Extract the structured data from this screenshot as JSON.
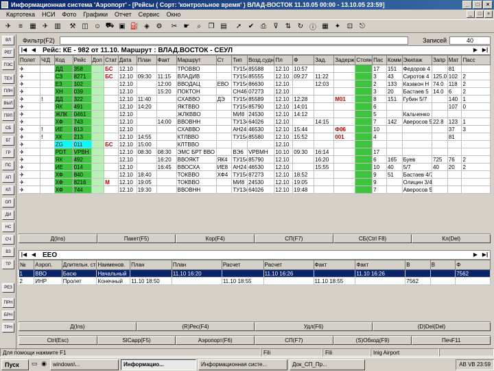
{
  "window": {
    "title": "Информационная система 'Аэропорт' - [Рейсы ( Сорт: 'контрольное время' ) ВЛАД-ВОСТОК 11.10.05 00:00 - 13.10.05 23:59]",
    "min": "_",
    "max": "□",
    "close": "×"
  },
  "menu": [
    "Картотека",
    "НСИ",
    "Фото",
    "Графики",
    "Отчет",
    "Сервис",
    "Окно"
  ],
  "mdi_controls": [
    "_",
    "□",
    "×"
  ],
  "left_tools": [
    "ВЛ",
    "РЕГ",
    "ПЭС",
    "ТЕХ",
    "ПЛН",
    "ВЫЛ",
    "ПРЛ",
    "СБ",
    "БГ",
    "ГР",
    "ПС",
    "АП",
    "КЛ",
    "ОП",
    "ДИ",
    "НС",
    "СЧ",
    "ВЗ",
    "ТР",
    "РЕЗ",
    "ПРН",
    "БРН",
    "ТРН"
  ],
  "flights": {
    "filter_label": "Фильтр(F2)",
    "filter_value": "",
    "record_label": "Записей",
    "record_count": "40",
    "header": "Рейс: КЕ - 982 от 11.10. Маршрут : ВЛАД.ВОСТОК - СЕУЛ",
    "columns": [
      "Полет",
      "Ч/Д",
      "Код",
      "Рейс",
      "Доп",
      "Стат",
      "Дата",
      "План",
      "Факт",
      "Маршрут",
      "Ст",
      "Тип",
      "Возд.судно",
      "Пл",
      "Ф",
      "Зад.",
      "Задерж",
      "Стоян",
      "Пас",
      "Комм",
      "Экипаж",
      "Запр",
      "Мат",
      "Пасс"
    ],
    "rows": [
      {
        "d": "✈",
        "cd": "ДД",
        "num": "358",
        "st": "",
        "extra": "БС",
        "date": "12.10",
        "plan": "",
        "fact": "",
        "route": "ТРОВВО",
        "s": "",
        "type": "ТУ154",
        "ac": "85588",
        "t1": "12.10",
        "t2": "10:57",
        "t3": "",
        "delay": "",
        "stand": "17",
        "pax": "151",
        "comm": "Федоров 4",
        "crew": "",
        "z": "",
        "m": "81",
        "p": "",
        "hl": ""
      },
      {
        "d": "✈",
        "cd": "СЗ",
        "num": "8271",
        "st": "",
        "extra": "БС",
        "date": "12.10",
        "plan": "09:30",
        "fact": "11:15",
        "route": "ВЛАДИВ",
        "s": "",
        "type": "ТУ154",
        "ac": "85555",
        "t1": "12.10",
        "t2": "09:27",
        "t3": "11:22",
        "delay": "",
        "stand": "3",
        "pax": "43",
        "comm": "Сиротов 4",
        "crew": "125.0",
        "z": "FE",
        "m": "102",
        "p": "2",
        "hl": ""
      },
      {
        "d": "✈",
        "cd": "ЕЗ",
        "num": "102",
        "st": "",
        "extra": "",
        "date": "12.10",
        "plan": "",
        "fact": "12:00",
        "route": "ВВОДАЦ",
        "s": "ЕВО",
        "type": "ТУ154",
        "ac": "86630",
        "t1": "12.10",
        "t2": "",
        "t3": "12:03",
        "delay": "",
        "stand": "2",
        "pax": "133",
        "comm": "Казакон Н",
        "crew": "74.0",
        "z": "",
        "m": "118",
        "p": "2",
        "hl": ""
      },
      {
        "d": "✈",
        "cd": "ХН",
        "num": "039",
        "st": "",
        "extra": "",
        "date": "12.10",
        "plan": "",
        "fact": "15:20",
        "route": "ПОКТОН",
        "s": "",
        "type": "СН46",
        "ac": "07273",
        "t1": "12.10",
        "t2": "",
        "t3": "",
        "delay": "",
        "stand": "3",
        "pax": "20",
        "comm": "Бастаев 5",
        "crew": "14.0",
        "z": "",
        "m": "6",
        "p": "2",
        "hl": ""
      },
      {
        "d": "✈",
        "cd": "ДД",
        "num": "322",
        "st": "",
        "extra": "",
        "date": "12.10",
        "plan": "11:40",
        "fact": "",
        "route": "СХАВВО",
        "s": "ДЭ",
        "type": "ТУ154",
        "ac": "85589",
        "t1": "12.10",
        "t2": "12:28",
        "t3": "",
        "delay": "М01",
        "stand": "8",
        "pax": "151",
        "comm": "Губин 5/7",
        "crew": "",
        "z": "",
        "m": "140",
        "p": "1",
        "hl": "!"
      },
      {
        "d": "✈",
        "cd": "ЯК",
        "num": "491",
        "st": "",
        "extra": "",
        "date": "12.10",
        "plan": "14:20",
        "fact": "",
        "route": "ЯКТВВО",
        "s": "",
        "type": "ТУ154",
        "ac": "85790",
        "t1": "12.10",
        "t2": "14:01",
        "t3": "",
        "delay": "",
        "stand": "6",
        "pax": "",
        "comm": "",
        "crew": "",
        "z": "",
        "m": "107",
        "p": "0",
        "hl": ""
      },
      {
        "d": "✈",
        "cd": "ЖЛК",
        "num": "0461",
        "st": "",
        "extra": "",
        "date": "12.10",
        "plan": "",
        "fact": "",
        "route": "ЖЛКВВО",
        "s": "",
        "type": "МИ8",
        "ac": "24530",
        "t1": "12.10",
        "t2": "14:12",
        "t3": "",
        "delay": "",
        "stand": "5",
        "pax": "",
        "comm": "Кальченко",
        "crew": "",
        "z": "",
        "m": "",
        "p": "",
        "hl": ""
      },
      {
        "d": "✈",
        "cd": "ХФ",
        "num": "743",
        "st": "",
        "extra": "",
        "date": "12.10",
        "plan": "",
        "fact": "14:00",
        "route": "ВВОВНН",
        "s": "",
        "type": "ТУ134",
        "ac": "64026",
        "t1": "12.10",
        "t2": "",
        "t3": "14:15",
        "delay": "",
        "stand": "7",
        "pax": "142",
        "comm": "Аверосов 5",
        "crew": "22.8",
        "z": "БЕ",
        "m": "123",
        "p": "1",
        "hl": ""
      },
      {
        "d": "✈",
        "cd": "ИЕ",
        "num": "813",
        "st": "",
        "extra": "",
        "date": "12.10",
        "plan": "",
        "fact": "",
        "route": "СХАВВО",
        "s": "",
        "type": "АН24",
        "ac": "46530",
        "t1": "12.10",
        "t2": "15:44",
        "t3": "",
        "delay": "Ф06",
        "stand": "10",
        "pax": "",
        "comm": "",
        "crew": "",
        "z": "",
        "m": "37",
        "p": "3",
        "hl": "!"
      },
      {
        "d": "✈",
        "cd": "ХК",
        "num": "213",
        "st": "",
        "extra": "",
        "date": "12.10",
        "plan": "14:55",
        "fact": "",
        "route": "КТЛВВО",
        "s": "",
        "type": "ТУ154",
        "ac": "85580",
        "t1": "12.10",
        "t2": "15:52",
        "t3": "",
        "delay": "001",
        "stand": "4",
        "pax": "",
        "comm": "",
        "crew": "",
        "z": "",
        "m": "81",
        "p": "",
        "hl": "!"
      },
      {
        "d": "✈",
        "cd": "ZG",
        "num": "011",
        "st": "",
        "extra": "БС",
        "date": "12.10",
        "plan": "15:00",
        "fact": "",
        "route": "КЛТВВО",
        "s": "",
        "type": "",
        "ac": "",
        "t1": "12.10",
        "t2": "",
        "t3": "",
        "delay": "",
        "stand": "",
        "pax": "",
        "comm": "",
        "crew": "",
        "z": "",
        "m": "",
        "p": "",
        "hl": "cy"
      },
      {
        "d": "✈",
        "cd": "PDT",
        "num": "VPBH",
        "st": "",
        "extra": "",
        "date": "12.10",
        "plan": "08:30",
        "fact": "08:30",
        "route": "ЭМС БРТ ВВО",
        "s": "",
        "type": "ВЭ6",
        "ac": "VPBMH",
        "t1": "10.10",
        "t2": "09:30",
        "t3": "16:14",
        "delay": "",
        "stand": "17",
        "pax": "",
        "comm": "",
        "crew": "",
        "z": "",
        "m": "",
        "p": "",
        "hl": ""
      },
      {
        "d": "✈",
        "cd": "ЯК",
        "num": "492",
        "st": "",
        "extra": "",
        "date": "12.10",
        "plan": "",
        "fact": "16:20",
        "route": "ВВОЯКТ",
        "s": "ЯК4",
        "type": "ТУ154",
        "ac": "85790",
        "t1": "12.10",
        "t2": "",
        "t3": "16:20",
        "delay": "",
        "stand": "6",
        "pax": "165",
        "comm": "Буев",
        "crew": "725",
        "z": "64",
        "m": "76",
        "p": "2",
        "hl": ""
      },
      {
        "d": "✈",
        "cd": "ИЕ",
        "num": "014",
        "st": "",
        "extra": "",
        "date": "12.10",
        "plan": "",
        "fact": "16:45",
        "route": "ВВОСХА",
        "s": "ИЕ8",
        "type": "АН24",
        "ac": "46530",
        "t1": "12.10",
        "t2": "",
        "t3": "15:55",
        "delay": "",
        "stand": "10",
        "pax": "40",
        "comm": "5/7",
        "crew": "40",
        "z": "56",
        "m": "20",
        "p": "2",
        "hl": ""
      },
      {
        "d": "✈",
        "cd": "ХФ",
        "num": "840",
        "st": "",
        "extra": "",
        "date": "12.10",
        "plan": "18:40",
        "fact": "",
        "route": "ТОКВВО",
        "s": "ХФ4",
        "type": "ТУ154",
        "ac": "87273",
        "t1": "12.10",
        "t2": "18:52",
        "t3": "",
        "delay": "",
        "stand": "9",
        "pax": "51",
        "comm": "Бастаев 4/7",
        "crew": "",
        "z": "",
        "m": "",
        "p": "",
        "hl": ""
      },
      {
        "d": "✈",
        "cd": "ХФ",
        "num": "8216",
        "st": "",
        "extra": "М",
        "date": "12.10",
        "plan": "19:05",
        "fact": "",
        "route": "ТОКВВО",
        "s": "",
        "type": "МИ8",
        "ac": "24530",
        "t1": "12.10",
        "t2": "19:05",
        "t3": "",
        "delay": "",
        "stand": "9",
        "pax": "",
        "comm": "Олицин 3/4",
        "crew": "",
        "z": "",
        "m": "",
        "p": "",
        "hl": ""
      },
      {
        "d": "✈",
        "cd": "ХФ",
        "num": "744",
        "st": "",
        "extra": "",
        "date": "12.10",
        "plan": "19:30",
        "fact": "",
        "route": "ВВОВНН",
        "s": "",
        "type": "ТУ134",
        "ac": "64026",
        "t1": "12.10",
        "t2": "19:48",
        "t3": "",
        "delay": "",
        "stand": "7",
        "pax": "",
        "comm": "Аверосов 5",
        "crew": "",
        "z": "",
        "m": "",
        "p": "",
        "hl": ""
      }
    ],
    "buttons": [
      "Д(Ins)",
      "Пакет(F5)",
      "Кор(F4)",
      "СП(F7)",
      "СБ(Ctrl F8)",
      "Кл(Del)"
    ]
  },
  "route": {
    "header": "ЕЕО",
    "columns": [
      "№",
      "Аэроп.",
      "Длительн. стоянки",
      "Наименов.",
      "План",
      "План",
      "Расчет",
      "Расчет",
      "Факт",
      "Факт",
      "В",
      "В",
      "Ф"
    ],
    "rows": [
      {
        "n": "1",
        "ap": "ВВО",
        "dl": "Басю",
        "name": "Начальный",
        "p1": "",
        "p2": "11.10 16:20",
        "r1": "",
        "r2": "11.10 16:26",
        "f1": "",
        "f2": "11.10 16:26",
        "v1": "",
        "v2": "",
        "f": "7562"
      },
      {
        "n": "2",
        "ap": "ИНР",
        "dl": "Пролет",
        "name": "Конечный",
        "p1": "11.10 18:50",
        "p2": "",
        "r1": "11.10 18:55",
        "r2": "",
        "f1": "11.10 18:55",
        "f2": "",
        "v1": "7562",
        "v2": "",
        "f": ""
      }
    ],
    "buttons": [
      "Д(Ins)",
      "(R)Рес(F4)",
      "Удл(F6)",
      "(D)Del(Del)"
    ]
  },
  "bottom_buttons": [
    "Ctrl(Esc)",
    "SICapp(F5)",
    "Аэропорт(F6)",
    "СП(F7)",
    "(S)Обход(F9)",
    "ПечF11"
  ],
  "status": {
    "hint": "Для помощи нажмите F1",
    "f2": "Fili",
    "f3": "Fili",
    "f4": "Inig Airport",
    "f5": ""
  },
  "taskbar": {
    "start": "Пуск",
    "tasks": [
      "windows\\...",
      "Информацио...",
      "Информационная систе...",
      "Док_СП_Пр..."
    ],
    "active_index": 1,
    "tray": "AB  VB  23:59"
  }
}
